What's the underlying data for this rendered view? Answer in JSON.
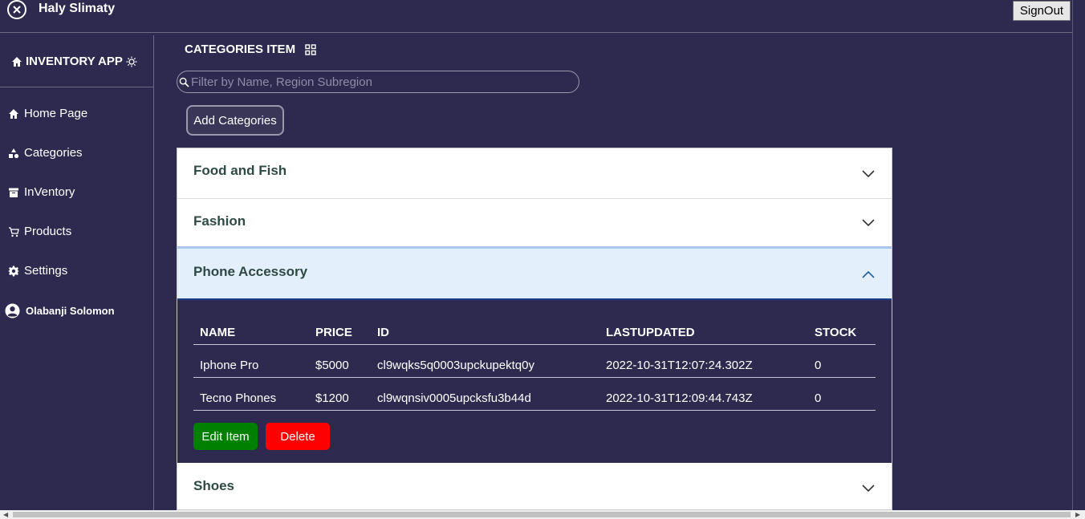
{
  "topbar": {
    "app_name": "Haly Slimaty",
    "signout_label": "SignOut"
  },
  "sidebar": {
    "brand": "INVENTORY APP",
    "items": [
      {
        "label": "Home Page",
        "icon": "home-icon"
      },
      {
        "label": "Categories",
        "icon": "shapes-icon"
      },
      {
        "label": "InVentory",
        "icon": "archive-icon"
      },
      {
        "label": "Products",
        "icon": "cart-icon"
      },
      {
        "label": "Settings",
        "icon": "gear-icon"
      }
    ],
    "user_name": "Olabanji Solomon"
  },
  "main": {
    "title": "CATEGORIES ITEM",
    "search_placeholder": "Filter by Name, Region Subregion",
    "add_button": "Add Categories",
    "categories": [
      {
        "name": "Food and Fish",
        "expanded": false
      },
      {
        "name": "Fashion",
        "expanded": false
      },
      {
        "name": "Phone Accessory",
        "expanded": true
      },
      {
        "name": "Shoes",
        "expanded": false
      }
    ],
    "table": {
      "headers": [
        "NAME",
        "PRICE",
        "ID",
        "LASTUPDATED",
        "STOCK"
      ],
      "rows": [
        [
          "Iphone Pro",
          "$5000",
          "cl9wqks5q0003upckupektq0y",
          "2022-10-31T12:07:24.302Z",
          "0"
        ],
        [
          "Tecno Phones",
          "$1200",
          "cl9wqnsiv0005upcksfu3b44d",
          "2022-10-31T12:09:44.743Z",
          "0"
        ]
      ]
    },
    "edit_button": "Edit Item",
    "delete_button": "Delete"
  },
  "colors": {
    "background": "#2e2a4f",
    "edit": "#008000",
    "delete": "#ff0000",
    "expanded_header": "#e3effb"
  }
}
